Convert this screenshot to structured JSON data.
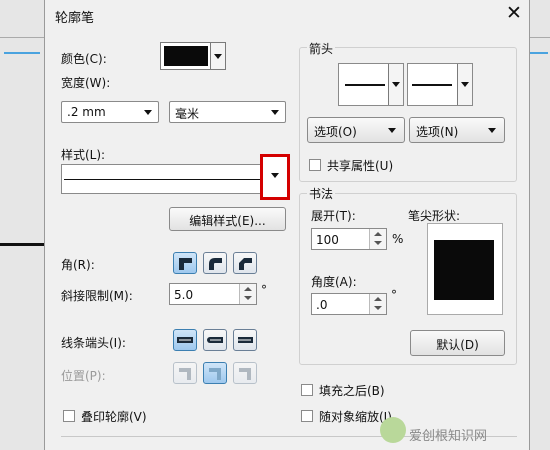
{
  "dialog": {
    "title": "轮廓笔"
  },
  "color": {
    "label": "颜色(C):",
    "value": "#0a0a0a"
  },
  "width": {
    "label": "宽度(W):",
    "value": ".2 mm",
    "unit": "毫米"
  },
  "style": {
    "label": "样式(L):",
    "edit_button": "编辑样式(E)..."
  },
  "corners": {
    "label": "角(R):"
  },
  "miter": {
    "label": "斜接限制(M):",
    "value": "5.0",
    "unit": "°"
  },
  "line_caps": {
    "label": "线条端头(I):"
  },
  "position": {
    "label": "位置(P):"
  },
  "overprint": {
    "label": "叠印轮廓(V)"
  },
  "arrows": {
    "label": "箭头",
    "left_options": "选项(O)",
    "right_options": "选项(N)",
    "share_label": "共享属性(U)"
  },
  "calligraphy": {
    "label": "书法",
    "stretch_label": "展开(T):",
    "stretch_value": "100",
    "stretch_unit": "%",
    "angle_label": "角度(A):",
    "angle_value": ".0",
    "angle_unit": "°",
    "nib_label": "笔尖形状:",
    "default_button": "默认(D)"
  },
  "behind_fill": {
    "label": "填充之后(B)"
  },
  "scale_with_object": {
    "label": "随对象缩放(J)"
  },
  "watermark": {
    "text": "爱创根知识网"
  },
  "icons": {
    "close": "close-icon",
    "dropdown": "chevron-down-icon"
  }
}
